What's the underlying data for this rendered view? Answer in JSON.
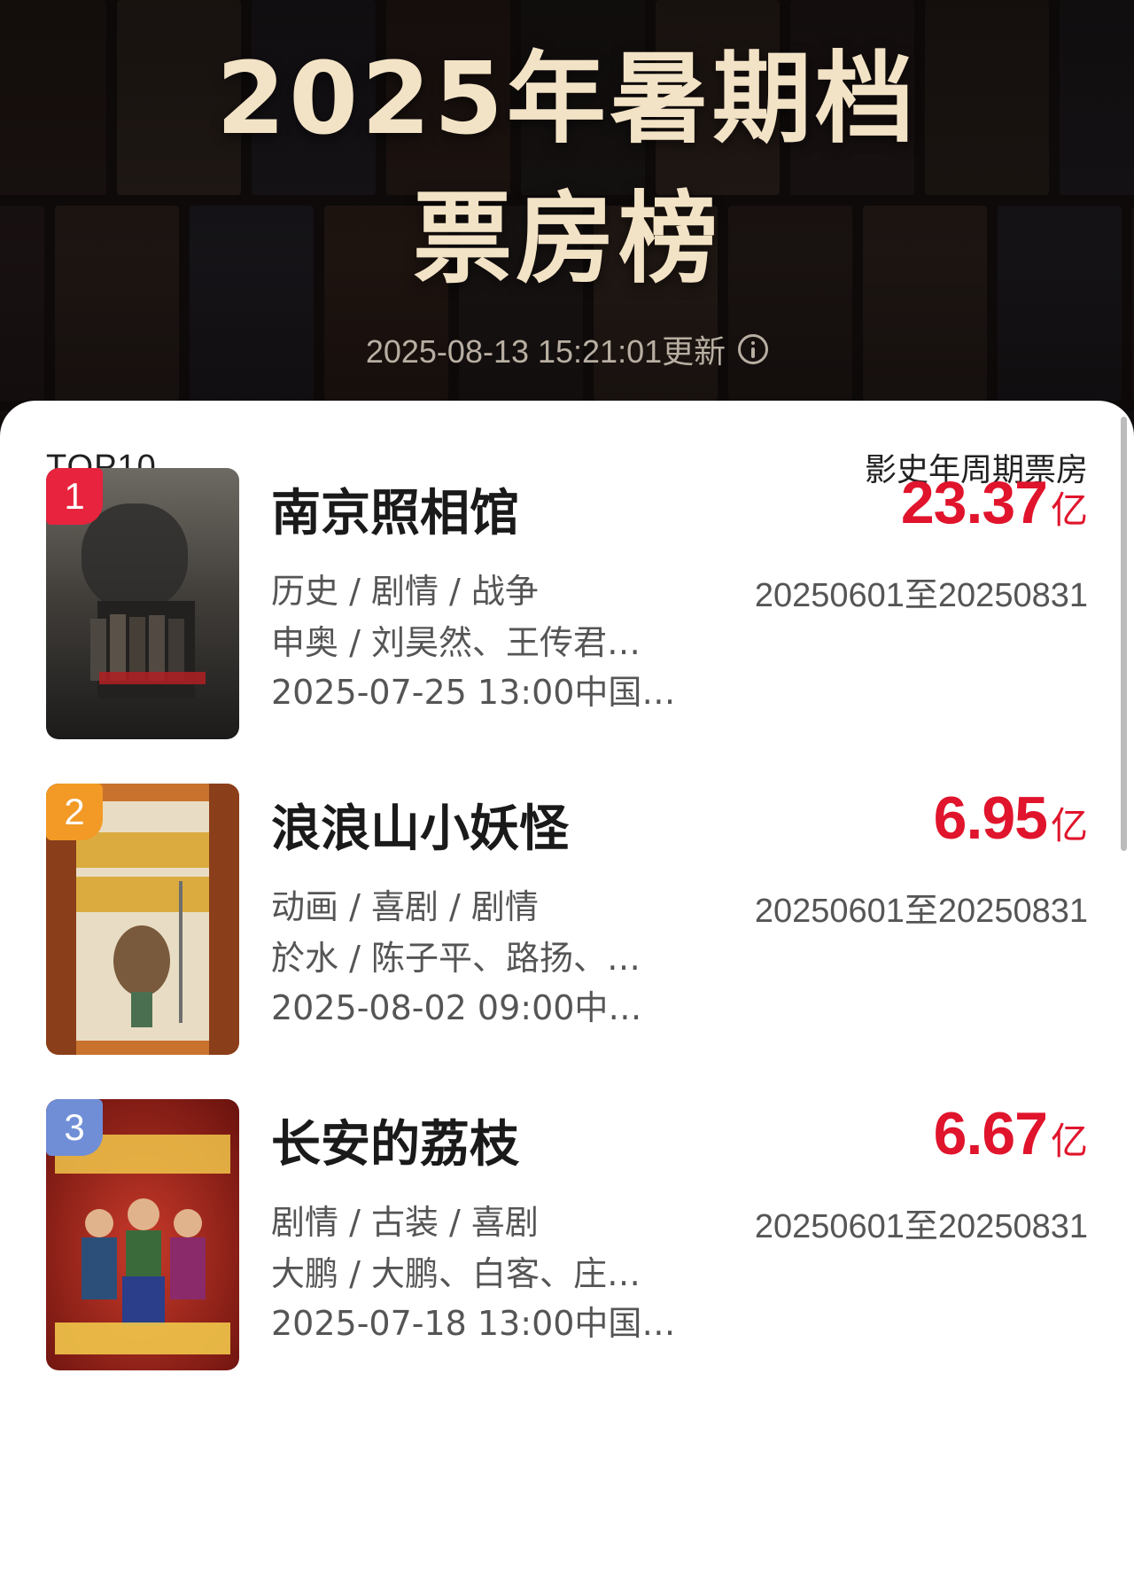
{
  "header": {
    "title_line1": "2025年暑期档",
    "title_line2": "票房榜",
    "updated_text": "2025-08-13 15:21:01更新",
    "info_icon": "info-circle-icon"
  },
  "list": {
    "top_label": "TOP10",
    "ranking_type": "影史年周期票房"
  },
  "colors": {
    "box_office_red": "#e0142c",
    "rank1": "#e8233e",
    "rank2": "#f29a25",
    "rank3": "#6f8ed6",
    "title_cream": "#f3e3c6"
  },
  "movies": [
    {
      "rank": "1",
      "title": "南京照相馆",
      "box_office_value": "23.37",
      "box_office_unit": "亿",
      "genres": "历史 / 剧情 / 战争",
      "people": "申奥 / 刘昊然、王传君…",
      "release": "2025-07-25 13:00中国…",
      "period": "20250601至20250831",
      "poster_icon": "movie-poster"
    },
    {
      "rank": "2",
      "title": "浪浪山小妖怪",
      "box_office_value": "6.95",
      "box_office_unit": "亿",
      "genres": "动画 / 喜剧 / 剧情",
      "people": "於水 / 陈子平、路扬、…",
      "release": "2025-08-02 09:00中…",
      "period": "20250601至20250831",
      "poster_icon": "movie-poster"
    },
    {
      "rank": "3",
      "title": "长安的荔枝",
      "box_office_value": "6.67",
      "box_office_unit": "亿",
      "genres": "剧情 / 古装 / 喜剧",
      "people": "大鹏 / 大鹏、白客、庄…",
      "release": "2025-07-18 13:00中国…",
      "period": "20250601至20250831",
      "poster_icon": "movie-poster"
    }
  ]
}
